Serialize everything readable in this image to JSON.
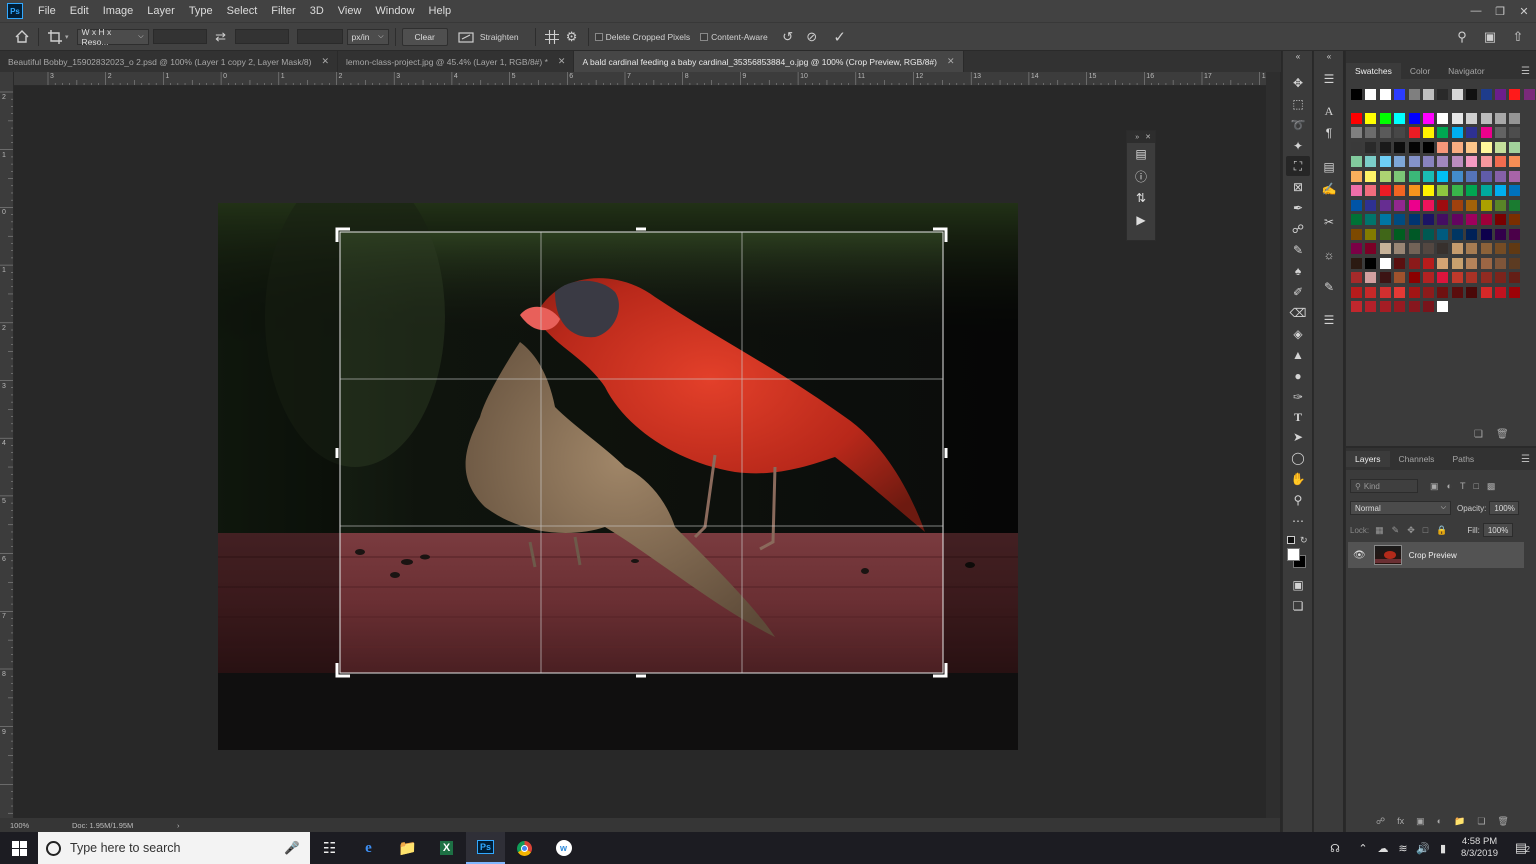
{
  "menubar": {
    "logo": "Ps",
    "items": [
      "File",
      "Edit",
      "Image",
      "Layer",
      "Type",
      "Select",
      "Filter",
      "3D",
      "View",
      "Window",
      "Help"
    ]
  },
  "options": {
    "ratio_preset": "W x H x Reso...",
    "unit": "px/in",
    "clear_label": "Clear",
    "straighten_label": "Straighten",
    "delete_cropped_label": "Delete Cropped Pixels",
    "content_aware_label": "Content-Aware"
  },
  "tabs": [
    {
      "label": "Beautiful Bobby_15902832023_o 2.psd @ 100% (Layer 1 copy 2, Layer Mask/8)",
      "active": false
    },
    {
      "label": "lemon-class-project.jpg @ 45.4% (Layer 1, RGB/8#) *",
      "active": false
    },
    {
      "label": "A bald cardinal feeding a baby cardinal_35356853884_o.jpg @ 100% (Crop Preview, RGB/8#)",
      "active": true
    }
  ],
  "ruler_top_labels": [
    "3",
    "2",
    "1",
    "0",
    "1",
    "2",
    "3",
    "4",
    "5",
    "6",
    "7",
    "8",
    "9",
    "10",
    "11",
    "12",
    "13",
    "14",
    "15",
    "16",
    "17",
    "18"
  ],
  "ruler_left_labels": [
    "2",
    "1",
    "0",
    "1",
    "2",
    "3",
    "4",
    "5",
    "6",
    "7",
    "8",
    "9"
  ],
  "status": {
    "zoom": "100%",
    "doc": "Doc: 1.95M/1.95M"
  },
  "swatches_panel": {
    "tabs": [
      "Swatches",
      "Color",
      "Navigator"
    ]
  },
  "swatch_colors": [
    [
      "#000000",
      "#ffffff",
      "#ffffff",
      "#2b3cff",
      "#7f7f7f",
      "#bfbfbf",
      "#2a2a2a",
      "#d8d8d8",
      "#111111",
      "#1e3c8c",
      "#6b1e8c",
      "#ff1a1a",
      "#7a2a7a"
    ],
    [
      "#ff0000",
      "#ffff00",
      "#00ff00",
      "#00ffff",
      "#0000ff",
      "#ff00ff",
      "#ffffff",
      "#e6e6e6",
      "#d0d0d0",
      "#bcbcbc",
      "#a8a8a8",
      "#959595"
    ],
    [
      "#808080",
      "#6c6c6c",
      "#5a5a5a",
      "#474747",
      "#ed1c24",
      "#fff200",
      "#00a651",
      "#00aeef",
      "#2e3192",
      "#ec008c",
      "#636363",
      "#4d4d4d"
    ],
    [
      "#3a3a3a",
      "#2a2a2a",
      "#1a1a1a",
      "#0d0d0d",
      "#050505",
      "#000000",
      "#f7977a",
      "#f9ad81",
      "#fdc68a",
      "#fff79a",
      "#c4df9b",
      "#a3d39c"
    ],
    [
      "#82ca9d",
      "#7bcdc8",
      "#6ecff6",
      "#7ea7d8",
      "#8493ca",
      "#8882be",
      "#a187be",
      "#bc8dbf",
      "#f49ac2",
      "#f6989d",
      "#f26c4f",
      "#f68e55"
    ],
    [
      "#fbaf5c",
      "#fff467",
      "#acd372",
      "#7cc576",
      "#3bb878",
      "#1abbb4",
      "#00bff3",
      "#438ccb",
      "#5574b9",
      "#605ca8",
      "#8560a8",
      "#a864a8"
    ],
    [
      "#f06ea9",
      "#f26d7d",
      "#ed1c24",
      "#f26522",
      "#f7941d",
      "#fff200",
      "#8dc63f",
      "#39b54a",
      "#00a651",
      "#00a99d",
      "#00aeef",
      "#0072bc"
    ],
    [
      "#0054a6",
      "#2e3192",
      "#662d91",
      "#92278f",
      "#ec008c",
      "#ed145b",
      "#9e0b0f",
      "#a0410d",
      "#a36209",
      "#aba000",
      "#598527",
      "#1a7b30"
    ],
    [
      "#007236",
      "#00746b",
      "#0076a3",
      "#004b80",
      "#003471",
      "#1b1464",
      "#440e62",
      "#630460",
      "#9e005d",
      "#9e0039",
      "#790000",
      "#7b2e00"
    ],
    [
      "#7d4900",
      "#827b00",
      "#406618",
      "#005e20",
      "#005826",
      "#005952",
      "#005b7f",
      "#003663",
      "#002157",
      "#0d004c",
      "#32004b",
      "#4b0049"
    ],
    [
      "#7b0046",
      "#7a0026",
      "#c7b299",
      "#998675",
      "#736357",
      "#534741",
      "#37302d",
      "#c69c6d",
      "#a67c52",
      "#8c6239",
      "#754c24",
      "#603913"
    ],
    [
      "#2b1a12",
      "#000000",
      "#ffffff",
      "#5a1010",
      "#8b1a1a",
      "#b71c1c",
      "#d4a373",
      "#c8a06e",
      "#b5835a",
      "#9c6644",
      "#7f5539",
      "#5c3b22"
    ],
    [
      "#a52a2a",
      "#d2a0a0",
      "#3c1414",
      "#a0522d",
      "#8b0000",
      "#b22222",
      "#dc143c",
      "#c0392b",
      "#a93226",
      "#922b21",
      "#7b241c",
      "#641e16"
    ],
    [
      "#b71c1c",
      "#c62828",
      "#d32f2f",
      "#e53935",
      "#a31515",
      "#8e1b1b",
      "#6f1010",
      "#5a0d0d",
      "#4a0808",
      "#d62828",
      "#c1121f",
      "#9d0208"
    ],
    [
      "#c1272d",
      "#b3202a",
      "#a51d24",
      "#961a21",
      "#87171e",
      "#78141b",
      "#ffffff"
    ]
  ],
  "layers_panel": {
    "tabs": [
      "Layers",
      "Channels",
      "Paths"
    ],
    "kind_label": "Kind",
    "blend_mode": "Normal",
    "opacity_label": "Opacity:",
    "opacity_value": "100%",
    "lock_label": "Lock:",
    "fill_label": "Fill:",
    "fill_value": "100%",
    "layer_name": "Crop Preview"
  },
  "taskbar": {
    "search_placeholder": "Type here to search",
    "time": "4:58 PM",
    "date": "8/3/2019",
    "notifications": "2"
  }
}
